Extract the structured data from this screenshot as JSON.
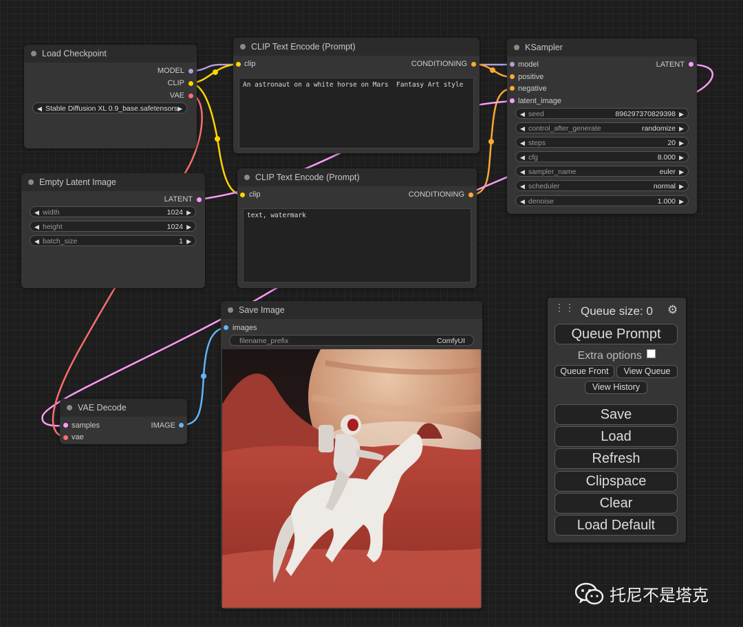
{
  "colors": {
    "model": "#b39ddb",
    "clip": "#ffd500",
    "vae": "#ff6e6e",
    "conditioning": "#ffa931",
    "latent": "#ff9cf9",
    "image": "#64b5f6"
  },
  "nodes": {
    "load_checkpoint": {
      "title": "Load Checkpoint",
      "outputs": [
        "MODEL",
        "CLIP",
        "VAE"
      ],
      "ckpt_value": "Stable Diffusion XL 0.9_base.safetensors"
    },
    "clip_pos": {
      "title": "CLIP Text Encode (Prompt)",
      "input": "clip",
      "output": "CONDITIONING",
      "text": "An astronaut on a white horse on Mars  Fantasy Art style"
    },
    "clip_neg": {
      "title": "CLIP Text Encode (Prompt)",
      "input": "clip",
      "output": "CONDITIONING",
      "text": "text, watermark"
    },
    "ksampler": {
      "title": "KSampler",
      "inputs": [
        "model",
        "positive",
        "negative",
        "latent_image"
      ],
      "output": "LATENT",
      "widgets": [
        {
          "label": "seed",
          "value": "896297370829398"
        },
        {
          "label": "control_after_generate",
          "value": "randomize"
        },
        {
          "label": "steps",
          "value": "20"
        },
        {
          "label": "cfg",
          "value": "8.000"
        },
        {
          "label": "sampler_name",
          "value": "euler"
        },
        {
          "label": "scheduler",
          "value": "normal"
        },
        {
          "label": "denoise",
          "value": "1.000"
        }
      ]
    },
    "empty_latent": {
      "title": "Empty Latent Image",
      "output": "LATENT",
      "widgets": [
        {
          "label": "width",
          "value": "1024"
        },
        {
          "label": "height",
          "value": "1024"
        },
        {
          "label": "batch_size",
          "value": "1"
        }
      ]
    },
    "vae_decode": {
      "title": "VAE Decode",
      "inputs": [
        "samples",
        "vae"
      ],
      "output": "IMAGE"
    },
    "save_image": {
      "title": "Save Image",
      "input": "images",
      "widget": {
        "label": "filename_prefix",
        "value": "ComfyUI"
      }
    }
  },
  "menu": {
    "queue_size": "Queue size: 0",
    "queue_prompt": "Queue Prompt",
    "extra_options": "Extra options",
    "queue_front": "Queue Front",
    "view_queue": "View Queue",
    "view_history": "View History",
    "buttons": [
      "Save",
      "Load",
      "Refresh",
      "Clipspace",
      "Clear",
      "Load Default"
    ]
  },
  "watermark": "托尼不是塔克"
}
